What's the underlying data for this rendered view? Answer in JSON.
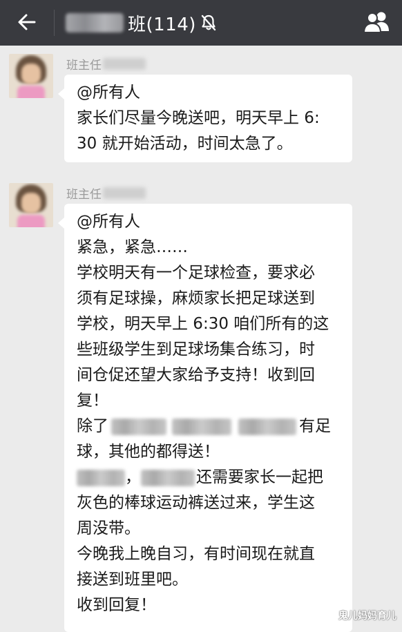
{
  "header": {
    "back_icon": "arrow-left-icon",
    "title_suffix": "班(114)",
    "mute_icon": "bell-slash-icon",
    "members_icon": "group-members-icon",
    "background": "#393a3f"
  },
  "messages": [
    {
      "sender": "班主任",
      "lines": [
        "@所有人",
        "家长们尽量今晚送吧，明天早上 6:",
        "30 就开始活动，时间太急了。"
      ]
    },
    {
      "sender": "班主任",
      "lines": [
        "@所有人",
        "紧急，紧急……",
        "学校明天有一个足球检查，要求必",
        "须有足球操，麻烦家长把足球送到",
        "学校，明天早上 6:30 咱们所有的这",
        "些班级学生到足球场集合练习，时",
        "间仓促还望大家给予支持！收到回",
        "复！"
      ],
      "line_except_prefix": "除了",
      "line_except_suffix": "有足",
      "line_ball": "球，其他的都得送！",
      "line_pants_comma": "，",
      "line_pants_suffix": "还需要家长一起把",
      "lines_after": [
        "灰色的棒球运动裤送过来，学生这",
        "周没带。",
        "今晚我上晚自习，有时间现在就直",
        "接送到班里吧。",
        "收到回复！"
      ]
    }
  ],
  "watermark": "鬼儿妈妈育儿"
}
